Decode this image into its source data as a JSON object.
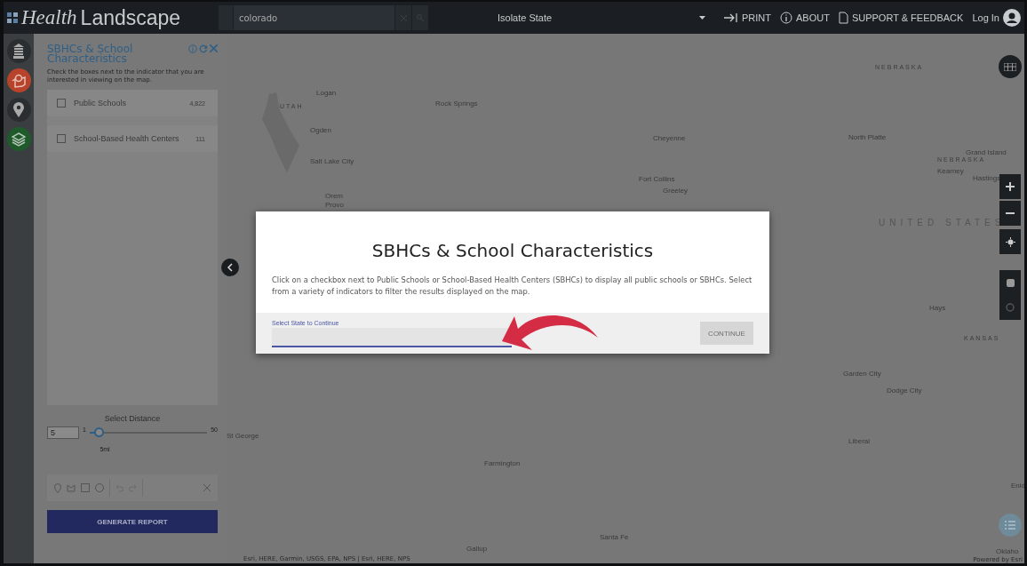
{
  "header": {
    "logo_italic": "Health",
    "logo_regular": "Landscape",
    "search_value": "colorado",
    "isolate_label": "Isolate State",
    "nav": [
      {
        "label": "PRINT",
        "kind": "print"
      },
      {
        "label": "ABOUT",
        "kind": "about"
      },
      {
        "label": "SUPPORT & FEEDBACK",
        "kind": "support"
      }
    ],
    "login": "Log In"
  },
  "rail": [
    {
      "kind": "building",
      "color": "#2a2e31"
    },
    {
      "kind": "map-pin",
      "color": "#b8432b"
    },
    {
      "kind": "pin",
      "color": "#2a2e31"
    },
    {
      "kind": "layers",
      "color": "#1f5b2a"
    }
  ],
  "panel": {
    "title": "SBHCs & School Characteristics",
    "description": "Check the boxes next to the indicator that you are interested in viewing on the map.",
    "items": [
      {
        "label": "Public Schools",
        "count": "4,822",
        "checked": false
      },
      {
        "label": "School-Based Health Centers",
        "count": "111",
        "checked": false
      }
    ],
    "distance": {
      "label": "Select Distance",
      "value": "5",
      "min": "1",
      "max": "50",
      "reading": "5mi",
      "level": 0.08
    },
    "generate_button": "GENERATE REPORT"
  },
  "map": {
    "labels": [
      {
        "text": "Logan",
        "kind": "city"
      },
      {
        "text": "Rock Springs",
        "kind": "city"
      },
      {
        "text": "UTAH",
        "kind": "region"
      },
      {
        "text": "Ogden",
        "kind": "city"
      },
      {
        "text": "Salt Lake City",
        "kind": "city"
      },
      {
        "text": "Orem",
        "kind": "city"
      },
      {
        "text": "Provo",
        "kind": "city"
      },
      {
        "text": "Cheyenne",
        "kind": "city"
      },
      {
        "text": "NEBRASKA",
        "kind": "region"
      },
      {
        "text": "North Platte",
        "kind": "city"
      },
      {
        "text": "Grand Island",
        "kind": "city"
      },
      {
        "text": "Kearney",
        "kind": "city"
      },
      {
        "text": "Hastings",
        "kind": "city"
      },
      {
        "text": "NEBRASKA",
        "kind": "region"
      },
      {
        "text": "Fort Collins",
        "kind": "city"
      },
      {
        "text": "Greeley",
        "kind": "city"
      },
      {
        "text": "UNITED STATES",
        "kind": "country"
      },
      {
        "text": "Hays",
        "kind": "city"
      },
      {
        "text": "KANSAS",
        "kind": "region"
      },
      {
        "text": "Garden City",
        "kind": "city"
      },
      {
        "text": "Dodge City",
        "kind": "city"
      },
      {
        "text": "Liberal",
        "kind": "city"
      },
      {
        "text": "St George",
        "kind": "city"
      },
      {
        "text": "Farmington",
        "kind": "city"
      },
      {
        "text": "Enid",
        "kind": "city"
      },
      {
        "text": "Santa Fe",
        "kind": "city"
      },
      {
        "text": "Gallup",
        "kind": "city"
      },
      {
        "text": "Oklaho",
        "kind": "city"
      }
    ],
    "attribution": "Esri, HERE, Garmin, USGS, EPA, NPS | Esri, HERE, NPS",
    "powered_by": "Powered by Esri"
  },
  "modal": {
    "title": "SBHCs & School Characteristics",
    "body": "Click on a checkbox next to Public Schools or School-Based Health Centers (SBHCs) to display all public schools or SBHCs. Select from a variety of indicators to filter the results displayed on the map.",
    "field_label": "Select State to Continue",
    "continue_button": "CONTINUE",
    "continue_disabled": true
  }
}
